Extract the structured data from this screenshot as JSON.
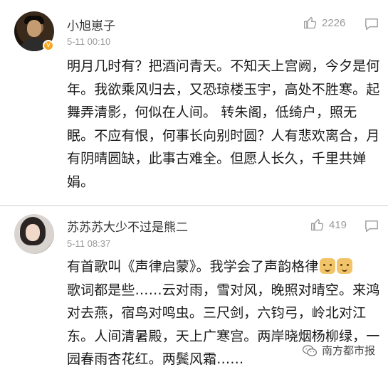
{
  "comments": [
    {
      "author": "小旭崽子",
      "time": "5-11 00:10",
      "likes": "2226",
      "badge_icon": "vip-badge-icon",
      "text": "明月几时有？把酒问青天。不知天上宫阙，今夕是何年。我欲乘风归去，又恐琼楼玉宇，高处不胜寒。起舞弄清影，何似在人间。 转朱阁，低绮户，照无眠。不应有恨，何事长向别时圆？人有悲欢离合，月有阴晴圆缺，此事古难全。但愿人长久，千里共婵娟。"
    },
    {
      "author": "苏苏苏大少不过是熊二",
      "time": "5-11 08:37",
      "likes": "419",
      "text_before_emoji": "有首歌叫《声律启蒙》。我学会了声韵格律",
      "text_after_emoji": "歌词都是些……云对雨，雪对风，晚照对晴空。来鸿对去燕，宿鸟对鸣虫。三尺剑，六钧弓，岭北对江东。人间清暑殿，天上广寒宫。两岸晓烟杨柳绿，一园春雨杏花红。两鬓风霜……",
      "emoji_icon": "doge-emoji-icon"
    }
  ],
  "watermark": {
    "text": "南方都市报",
    "icon": "wechat-logo-icon"
  },
  "colors": {
    "text_primary": "#1a1a1a",
    "text_secondary": "#999999",
    "divider": "#e6e6e6"
  }
}
